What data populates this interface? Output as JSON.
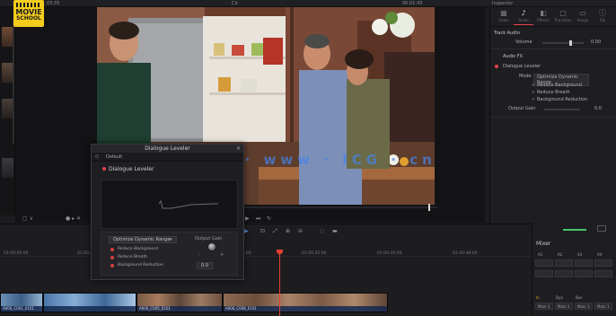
{
  "topbar": {
    "left_title": "03:35",
    "center_title": "Cir",
    "right_title": "00:01:43",
    "inspector_label": "Inspector"
  },
  "logo": {
    "line1": "MOVIE",
    "line2": "SCHOOL"
  },
  "viewer": {
    "controls": {
      "viewer_menu": "▢ ∨",
      "zoom": "● ▸ ✕",
      "skip_back": "⏮",
      "play": "▶",
      "skip_fwd": "⏭",
      "loop": "↻"
    }
  },
  "inspector": {
    "tabs": [
      {
        "glyph": "▦",
        "label": "Video"
      },
      {
        "glyph": "♪",
        "label": "Audio"
      },
      {
        "glyph": "◧",
        "label": "Effects"
      },
      {
        "glyph": "▢",
        "label": "Transition"
      },
      {
        "glyph": "▭",
        "label": "Image"
      },
      {
        "glyph": "ⓘ",
        "label": "File"
      }
    ],
    "section1": {
      "title": "Track Audio",
      "row_label": "Volume",
      "row_value": "0.00"
    },
    "section2": {
      "title": "Audio FX",
      "fx_name": "Dialogue Leveler",
      "mode_label": "Mode",
      "mode_value": "Optimize Dynamic Range",
      "checks": [
        "Reduce Background",
        "Reduce Breath",
        "Background Reduction"
      ],
      "level_label": "Output Gain",
      "level_value": "0.0"
    }
  },
  "dialog": {
    "title": "Dialogue Leveler",
    "close": "✕",
    "toolbar_preset": "Default",
    "fx_header": "Dialogue Leveler",
    "mode": "Optimize Dynamic Range",
    "options": [
      "Reduce Background",
      "Reduce Breath",
      "Background Reduction"
    ],
    "knob_label": "Output Gain",
    "knob_min": "-",
    "knob_max": "+",
    "gain_value": "0.0"
  },
  "watermark": "技艺CG · www · ICG · cn",
  "timeline": {
    "ruler": [
      "01:00:00:00",
      "01:00:08:00",
      "01:00:16:00",
      "01:00:24:00",
      "01:00:32:00",
      "01:00:40:00",
      "01:00:48:00"
    ],
    "clips": [
      "A006_C001_0101",
      "A006_C005_0101",
      "A006_C008_0101"
    ],
    "toolbar_glyphs": [
      "▶",
      "⊡",
      "⤢",
      "⊕",
      "⊖",
      "◌",
      "▬"
    ]
  },
  "mixer": {
    "title": "Mixer",
    "channels": [
      "A1",
      "A2",
      "A3",
      "A4"
    ],
    "rows": [
      "In",
      "Dyn",
      "Bus"
    ],
    "bus_labels": [
      "Main 1",
      "Main 1",
      "Main 1",
      "Main 1"
    ]
  },
  "colors": {
    "accent": "#e6414a",
    "playhead": "#e7412f",
    "logo": "#f3cc1c"
  }
}
